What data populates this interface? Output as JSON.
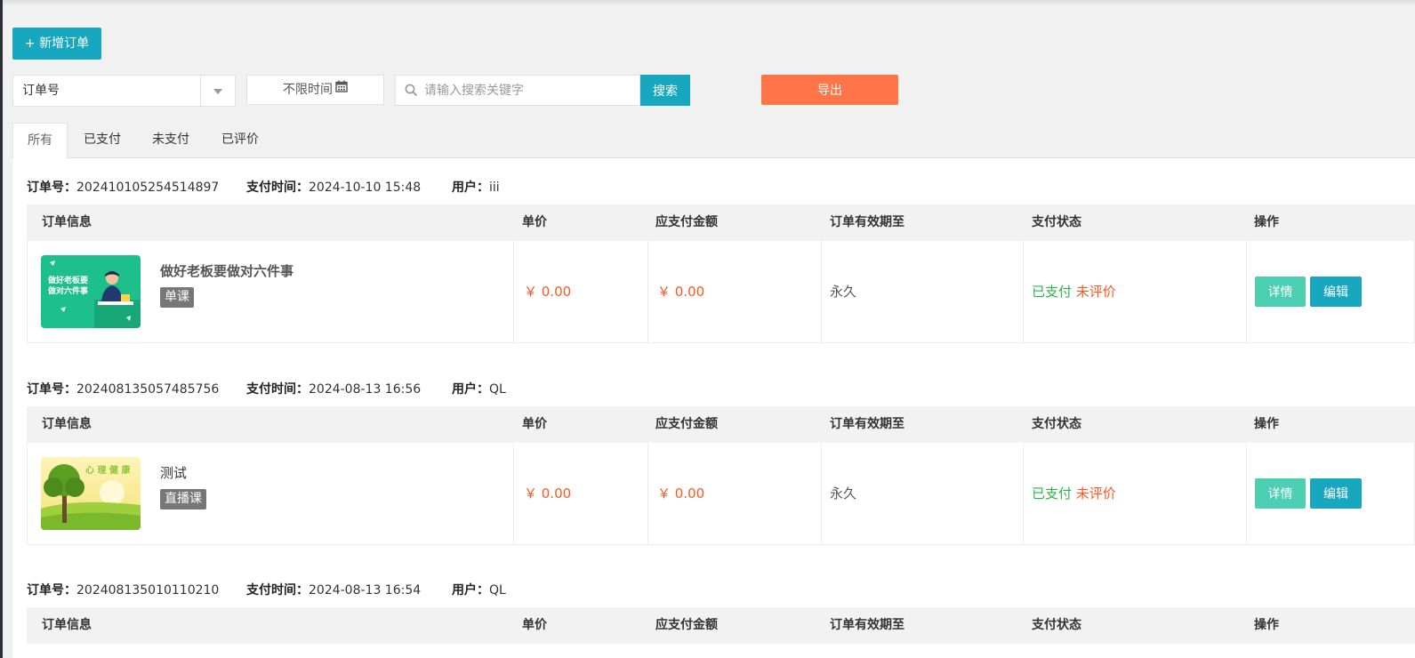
{
  "toolbar": {
    "add_label": "+ 新增订单",
    "search_field_select": "订单号",
    "time_filter": "不限时间",
    "search_placeholder": "请输入搜索关键字",
    "search_label": "搜索",
    "export_label": "导出"
  },
  "tabs": [
    {
      "label": "所有",
      "active": true
    },
    {
      "label": "已支付",
      "active": false
    },
    {
      "label": "未支付",
      "active": false
    },
    {
      "label": "已评价",
      "active": false
    }
  ],
  "labels": {
    "order_no": "订单号：",
    "pay_time": "支付时间：",
    "user": "用户："
  },
  "table_headers": [
    "订单信息",
    "单价",
    "应支付金额",
    "订单有效期至",
    "支付状态",
    "操作"
  ],
  "orders": [
    {
      "order_no": "202410105254514897",
      "pay_time": "2024-10-10 15:48",
      "user": "iii",
      "product_name": "做好老板要做对六件事",
      "product_tag": "单课",
      "thumb_text_1": "做好老板要",
      "thumb_text_2": "做对六件事",
      "unit_price": "￥ 0.00",
      "amount_due": "￥ 0.00",
      "valid_until": "永久",
      "pay_status": "已支付",
      "review_status": "未评价",
      "detail_label": "详情",
      "edit_label": "编辑"
    },
    {
      "order_no": "202408135057485756",
      "pay_time": "2024-08-13 16:56",
      "user": "QL",
      "product_name": "测试",
      "product_tag": "直播课",
      "thumb_text_1": "心 理 健 康",
      "unit_price": "￥ 0.00",
      "amount_due": "￥ 0.00",
      "valid_until": "永久",
      "pay_status": "已支付",
      "review_status": "未评价",
      "detail_label": "详情",
      "edit_label": "编辑"
    },
    {
      "order_no": "202408135010110210",
      "pay_time": "2024-08-13 16:54",
      "user": "QL"
    }
  ],
  "icons": {
    "calendar": "calendar-icon",
    "search": "search-icon",
    "dropdown": "chevron-down-icon"
  },
  "colors": {
    "primary": "#17a8bf",
    "export": "#ff7548",
    "price": "#ff5722",
    "paid": "#2db346",
    "detail_button": "#4ccfb2"
  }
}
